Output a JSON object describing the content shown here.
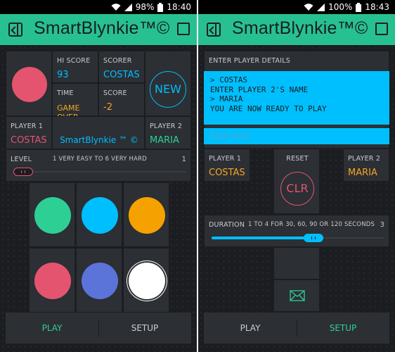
{
  "left": {
    "status": {
      "battery": "98%",
      "time": "18:40"
    },
    "app_title": "SmartBlynkie™©",
    "hi_score_label": "HI SCORE",
    "hi_score_value": "93",
    "scorer_label": "SCORER",
    "scorer_value": "COSTAS",
    "time_label": "TIME",
    "time_value": "GAME OVER",
    "score_label": "SCORE",
    "score_value": "-2",
    "new_label": "NEW",
    "player1_label": "PLAYER 1",
    "player1_value": "COSTAS",
    "center_label": "SmartBlynkie ™ ©",
    "player2_label": "PLAYER 2",
    "player2_value": "MARIA",
    "level_label": "LEVEL",
    "level_range": "1   VERY EASY TO  6  VERY HARD",
    "level_value": "1",
    "level_fraction": 0.0,
    "play_label": "PLAY",
    "setup_label": "SETUP",
    "buttons": [
      {
        "color": "#2ecf95"
      },
      {
        "color": "#00bfff"
      },
      {
        "color": "#f5a100"
      },
      {
        "color": "#e5546f"
      },
      {
        "color": "#5b74d9"
      },
      {
        "color": "#ffffff"
      }
    ]
  },
  "right": {
    "status": {
      "battery": "100%",
      "time": "18:43"
    },
    "app_title": "SmartBlynkie™©",
    "section_label": "ENTER   PLAYER  DETAILS",
    "terminal_lines": [
      "> COSTAS",
      "ENTER PLAYER 2'S NAME",
      "> MARIA",
      "YOU ARE NOW READY TO PLAY"
    ],
    "input_placeholder": "Type here",
    "player1_label": "PLAYER 1",
    "player1_value": "COSTAS",
    "reset_label": "RESET",
    "clr_label": "CLR",
    "player2_label": "PLAYER 2",
    "player2_value": "MARIA",
    "duration_label": "DURATION",
    "duration_range": "1 TO 4 FOR 30, 60, 90  OR 120 SECONDS",
    "duration_value": "3",
    "duration_fraction": 0.6,
    "play_label": "PLAY",
    "setup_label": "SETUP"
  },
  "colors": {
    "appbar": "#27c191",
    "accent_blue": "#00bfff",
    "accent_orange": "#f5a623",
    "accent_pink": "#e5546f",
    "accent_green": "#2ecf95"
  }
}
